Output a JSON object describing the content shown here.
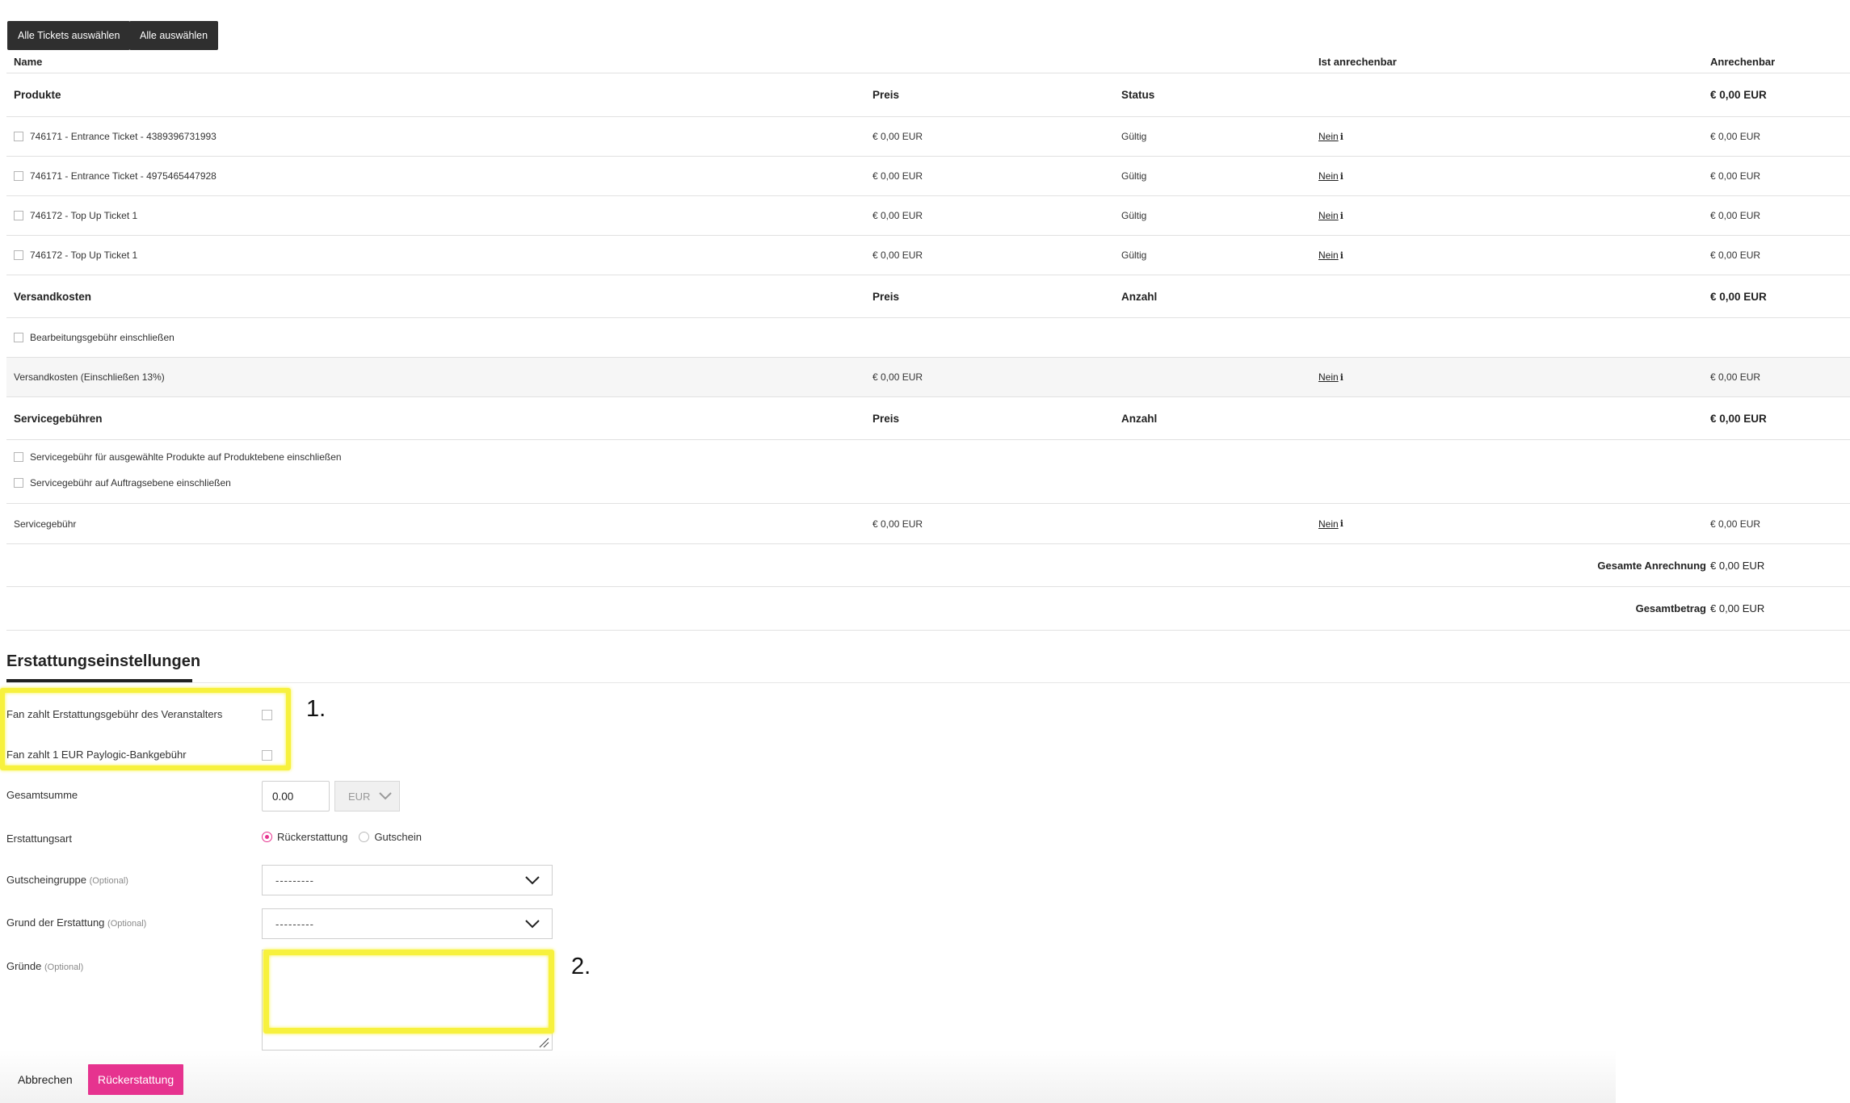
{
  "toolbar": {
    "select_all_tickets": "Alle Tickets auswählen",
    "select_all": "Alle auswählen"
  },
  "table": {
    "headers": {
      "name": "Name",
      "is_creditable": "Ist anrechenbar",
      "creditable": "Anrechenbar"
    },
    "products": {
      "title": "Produkte",
      "col_price": "Preis",
      "col_status": "Status",
      "total": "€ 0,00 EUR",
      "rows": [
        {
          "name": "746171 - Entrance Ticket - 4389396731993",
          "price": "€ 0,00 EUR",
          "status": "Gültig",
          "creditable": "Nein",
          "amount": "€ 0,00 EUR"
        },
        {
          "name": "746171 - Entrance Ticket - 4975465447928",
          "price": "€ 0,00 EUR",
          "status": "Gültig",
          "creditable": "Nein",
          "amount": "€ 0,00 EUR"
        },
        {
          "name": "746172 - Top Up Ticket 1",
          "price": "€ 0,00 EUR",
          "status": "Gültig",
          "creditable": "Nein",
          "amount": "€ 0,00 EUR"
        },
        {
          "name": "746172 - Top Up Ticket 1",
          "price": "€ 0,00 EUR",
          "status": "Gültig",
          "creditable": "Nein",
          "amount": "€ 0,00 EUR"
        }
      ]
    },
    "shipping": {
      "title": "Versandkosten",
      "col_price": "Preis",
      "col_count": "Anzahl",
      "total": "€ 0,00 EUR",
      "option": "Bearbeitungsgebühr einschließen",
      "row": {
        "name": "Versandkosten (Einschließen 13%)",
        "price": "€ 0,00 EUR",
        "creditable": "Nein",
        "amount": "€ 0,00 EUR"
      }
    },
    "service": {
      "title": "Servicegebühren",
      "col_price": "Preis",
      "col_count": "Anzahl",
      "total": "€ 0,00 EUR",
      "option_product": "Servicegebühr für ausgewählte Produkte auf Produktebene einschließen",
      "option_order": "Servicegebühr auf Auftragsebene einschließen",
      "row": {
        "name": "Servicegebühr",
        "price": "€ 0,00 EUR",
        "creditable": "Nein",
        "amount": "€ 0,00 EUR"
      }
    },
    "totals": {
      "credit_label": "Gesamte Anrechnung",
      "credit_value": "€ 0,00 EUR",
      "total_label": "Gesamtbetrag",
      "total_value": "€ 0,00 EUR"
    },
    "info_glyph": "i"
  },
  "refund_settings": {
    "title": "Erstattungseinstellungen",
    "fan_pays_fee_label": "Fan zahlt Erstattungsgebühr des Veranstalters",
    "fan_pays_bank_label": "Fan zahlt 1 EUR Paylogic-Bankgebühr",
    "total_label": "Gesamtsumme",
    "total_value": "0.00",
    "currency": "EUR",
    "refund_type_label": "Erstattungsart",
    "refund_type_options": [
      "Rückerstattung",
      "Gutschein"
    ],
    "refund_type_selected": "Rückerstattung",
    "voucher_group_label": "Gutscheingruppe",
    "optional": "(Optional)",
    "voucher_group_value": "---------",
    "reason_label": "Grund der Erstattung",
    "reason_value": "---------",
    "reasons_label": "Gründe"
  },
  "annotations": {
    "one": "1.",
    "two": "2."
  },
  "actions": {
    "cancel": "Abbrechen",
    "refund": "Rückerstattung"
  },
  "colors": {
    "accent": "#e6338f",
    "highlight": "#f7f13d",
    "dark_button": "#2f2f2f"
  }
}
